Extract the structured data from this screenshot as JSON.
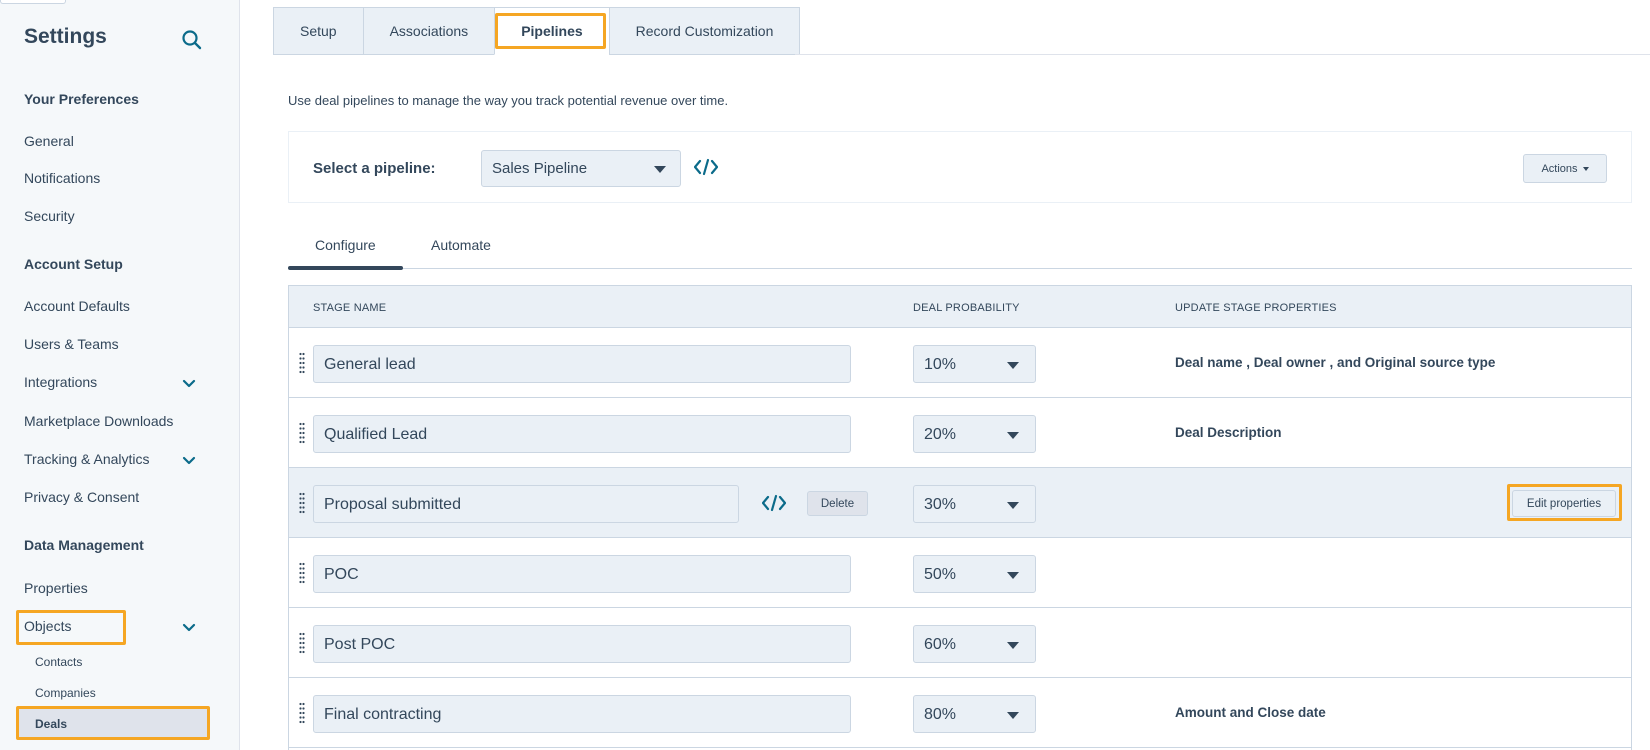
{
  "sidebar": {
    "title": "Settings",
    "sections": {
      "your_preferences": "Your Preferences",
      "account_setup": "Account Setup",
      "data_management": "Data Management"
    },
    "items": {
      "general": "General",
      "notifications": "Notifications",
      "security": "Security",
      "account_defaults": "Account Defaults",
      "users_teams": "Users & Teams",
      "integrations": "Integrations",
      "marketplace_downloads": "Marketplace Downloads",
      "tracking_analytics": "Tracking & Analytics",
      "privacy_consent": "Privacy & Consent",
      "properties": "Properties",
      "objects": "Objects"
    },
    "object_items": {
      "contacts": "Contacts",
      "companies": "Companies",
      "deals": "Deals"
    }
  },
  "top_tabs": {
    "setup": "Setup",
    "associations": "Associations",
    "pipelines": "Pipelines",
    "record_customization": "Record Customization"
  },
  "intro_text": "Use deal pipelines to manage the way you track potential revenue over time.",
  "pipeline_bar": {
    "label": "Select a pipeline:",
    "selected": "Sales Pipeline",
    "actions_label": "Actions"
  },
  "sub_tabs": {
    "configure": "Configure",
    "automate": "Automate"
  },
  "table": {
    "headers": {
      "stage_name": "STAGE NAME",
      "deal_probability": "DEAL PROBABILITY",
      "update_stage_properties": "UPDATE STAGE PROPERTIES"
    },
    "rows": [
      {
        "stage": "General lead",
        "probability": "10%",
        "properties": "Deal name , Deal owner , and Original source type"
      },
      {
        "stage": "Qualified Lead",
        "probability": "20%",
        "properties": "Deal Description"
      },
      {
        "stage": "Proposal submitted",
        "probability": "30%",
        "properties": "",
        "delete_label": "Delete",
        "edit_label": "Edit properties"
      },
      {
        "stage": "POC",
        "probability": "50%",
        "properties": ""
      },
      {
        "stage": "Post POC",
        "probability": "60%",
        "properties": ""
      },
      {
        "stage": "Final contracting",
        "probability": "80%",
        "properties": "Amount and Close date"
      }
    ]
  },
  "colors": {
    "text": "#33475b",
    "highlight": "#f5a623",
    "code_icon": "#0b6b8a",
    "sidebar_bg": "#f5f8fa",
    "field_bg": "#eaf0f6"
  }
}
